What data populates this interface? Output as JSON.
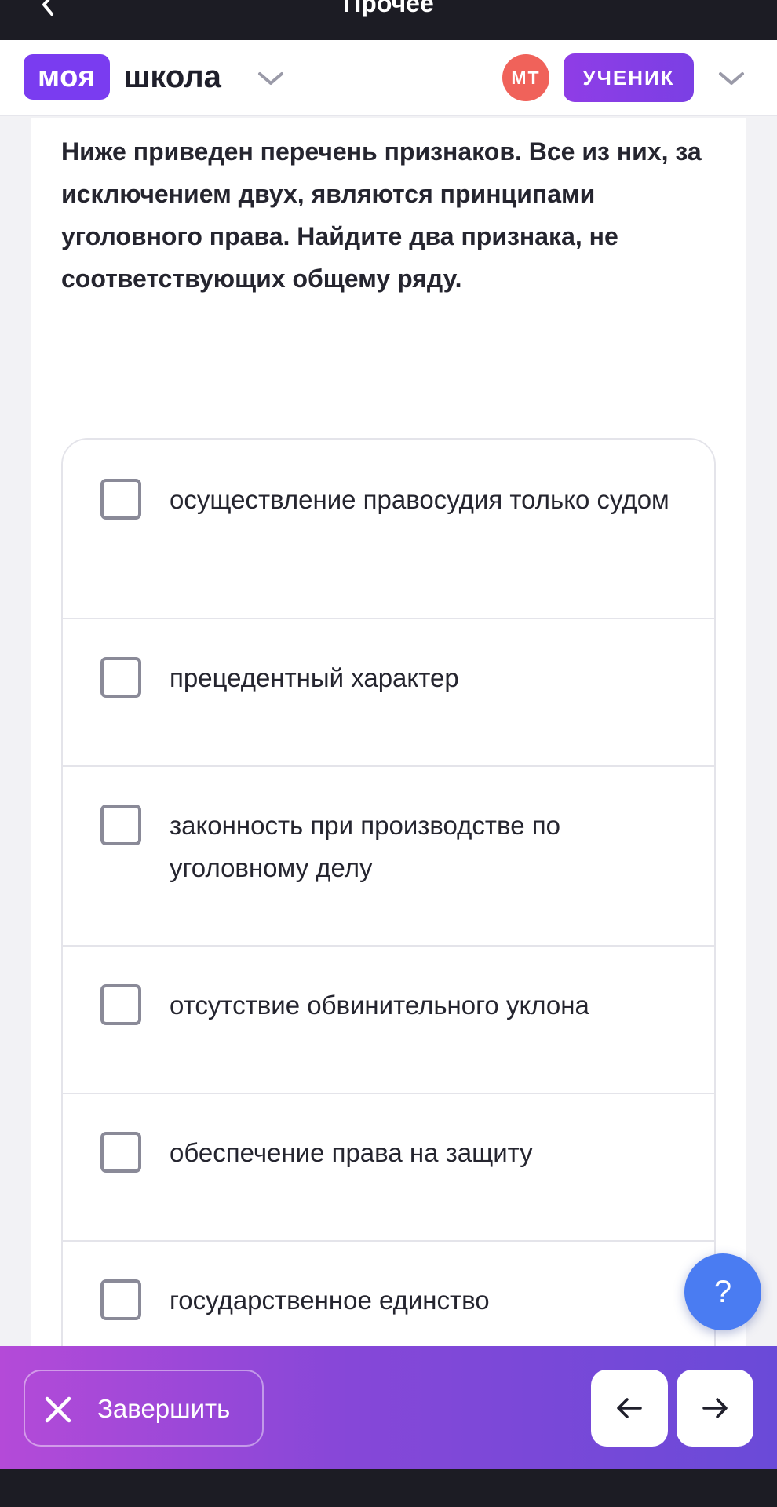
{
  "topbar": {
    "title": "Прочее"
  },
  "header": {
    "logo_part1": "моя",
    "logo_part2": "школа",
    "avatar_initials": "МТ",
    "role_label": "УЧЕНИК"
  },
  "question": {
    "text": "Ниже приведен перечень признаков. Все из них, за исключением двух, являются принципами уголовного права. Найдите два признака, не соответствующих общему ряду."
  },
  "options": [
    {
      "label": "осуществление правосудия только судом",
      "checked": false
    },
    {
      "label": "прецедентный характер",
      "checked": false
    },
    {
      "label": "законность при производстве по уголовному делу",
      "checked": false
    },
    {
      "label": "отсутствие обвинительного уклона",
      "checked": false
    },
    {
      "label": "обеспечение права на защиту",
      "checked": false
    },
    {
      "label": "государственное единство",
      "checked": false
    }
  ],
  "help": {
    "label": "?"
  },
  "actions": {
    "finish_label": "Завершить"
  },
  "colors": {
    "brand_purple": "#7a3cf0",
    "avatar_red": "#f0625a",
    "help_blue": "#4a7cf2",
    "action_gradient_start": "#b44ad8",
    "action_gradient_end": "#6a4ad8"
  },
  "icons": {
    "back": "chevron-left-icon",
    "dropdown": "chevron-down-icon",
    "finish": "close-icon",
    "prev": "arrow-left-icon",
    "next": "arrow-right-icon"
  }
}
